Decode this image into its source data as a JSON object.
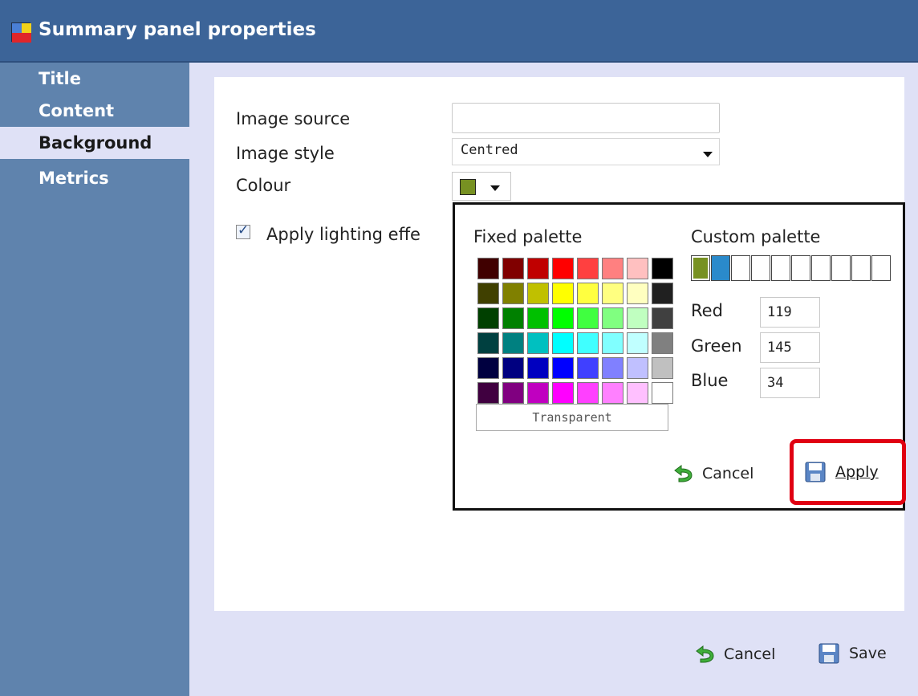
{
  "window": {
    "title": "Summary panel properties",
    "icon": "panel-grid-icon"
  },
  "sidebar": {
    "items": [
      {
        "label": "Title",
        "active": false
      },
      {
        "label": "Content",
        "active": false
      },
      {
        "label": "Background",
        "active": true
      },
      {
        "label": "Metrics",
        "active": false
      }
    ]
  },
  "form": {
    "image_source_label": "Image source",
    "image_source_value": "",
    "image_style_label": "Image style",
    "image_style_value": "Centred",
    "colour_label": "Colour",
    "colour_value": "#779122",
    "lighting_label": "Apply lighting effe",
    "lighting_checked": true
  },
  "picker": {
    "fixed_title": "Fixed palette",
    "custom_title": "Custom palette",
    "fixed_colors": [
      "#400000",
      "#800000",
      "#c00000",
      "#ff0000",
      "#ff4040",
      "#ff8080",
      "#ffc0c0",
      "#000000",
      "#404000",
      "#808000",
      "#c0c000",
      "#ffff00",
      "#ffff40",
      "#ffff80",
      "#ffffc0",
      "#202020",
      "#004000",
      "#008000",
      "#00c000",
      "#00ff00",
      "#40ff40",
      "#80ff80",
      "#c0ffc0",
      "#404040",
      "#004040",
      "#008080",
      "#00c0c0",
      "#00ffff",
      "#40ffff",
      "#80ffff",
      "#c0ffff",
      "#808080",
      "#000040",
      "#000080",
      "#0000c0",
      "#0000ff",
      "#4040ff",
      "#8080ff",
      "#c0c0ff",
      "#c0c0c0",
      "#400040",
      "#800080",
      "#c000c0",
      "#ff00ff",
      "#ff40ff",
      "#ff80ff",
      "#ffc0ff",
      "#ffffff"
    ],
    "custom_colors": [
      "#779122",
      "#2a8acb",
      "#ffffff",
      "#ffffff",
      "#ffffff",
      "#ffffff",
      "#ffffff",
      "#ffffff",
      "#ffffff",
      "#ffffff"
    ],
    "transparent_label": "Transparent",
    "red_label": "Red",
    "green_label": "Green",
    "blue_label": "Blue",
    "red_value": "119",
    "green_value": "145",
    "blue_value": "34",
    "cancel_label": "Cancel",
    "apply_label": "Apply"
  },
  "footer": {
    "cancel_label": "Cancel",
    "save_label": "Save"
  },
  "colors": {
    "titlebar": "#3c6498",
    "sidebar": "#5f83ad",
    "panel_bg": "#dfe1f6",
    "highlight": "#e00012"
  }
}
